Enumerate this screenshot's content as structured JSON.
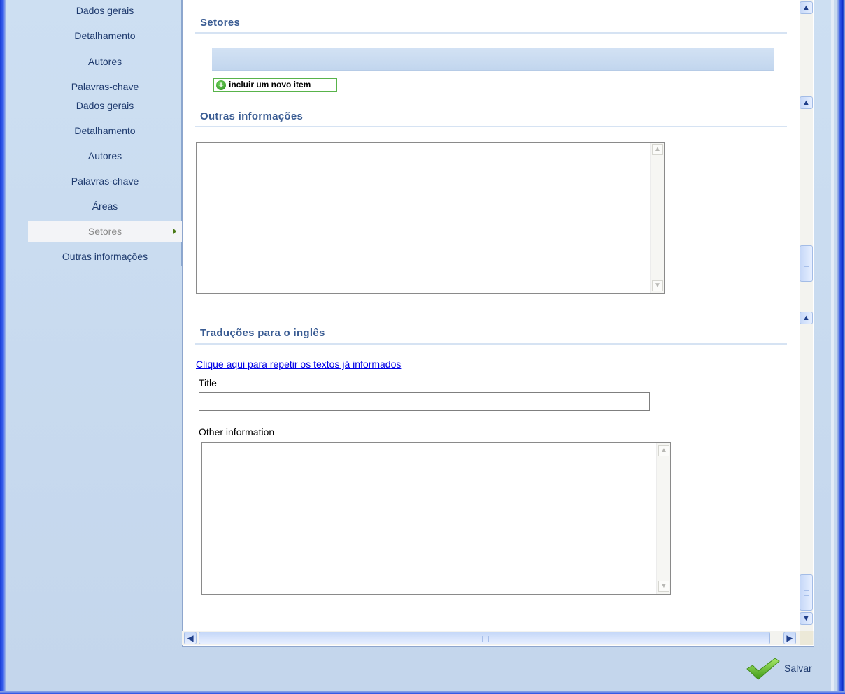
{
  "sidebar": {
    "items": [
      {
        "label": "Dados gerais"
      },
      {
        "label": "Detalhamento"
      },
      {
        "label": "Autores"
      },
      {
        "label": "Palavras-chave"
      },
      {
        "label": "Dados gerais"
      },
      {
        "label": "Detalhamento"
      },
      {
        "label": "Autores"
      },
      {
        "label": "Palavras-chave"
      },
      {
        "label": "Áreas"
      },
      {
        "label": "Setores",
        "active": true
      },
      {
        "label": "Outras informações"
      }
    ]
  },
  "main": {
    "setores": {
      "title": "Setores",
      "add_item_label": "incluir um novo item"
    },
    "outras_informacoes": {
      "title": "Outras informações",
      "value": ""
    },
    "traducoes": {
      "title": "Traduções para o inglês",
      "repeat_link": "Clique aqui para repetir os textos já informados",
      "title_label": "Title",
      "title_value": "",
      "other_info_label": "Other information",
      "other_info_value": ""
    }
  },
  "footer": {
    "save_label": "Salvar"
  },
  "icons": {
    "add": "plus-circle-icon",
    "save": "checkmark-icon",
    "scroll_up": "chevron-up-icon",
    "scroll_down": "chevron-down-icon",
    "scroll_left": "chevron-left-icon",
    "scroll_right": "chevron-right-icon"
  },
  "colors": {
    "accent": "#3a5c93",
    "link": "#0000e6",
    "add_border": "#58b34a"
  }
}
